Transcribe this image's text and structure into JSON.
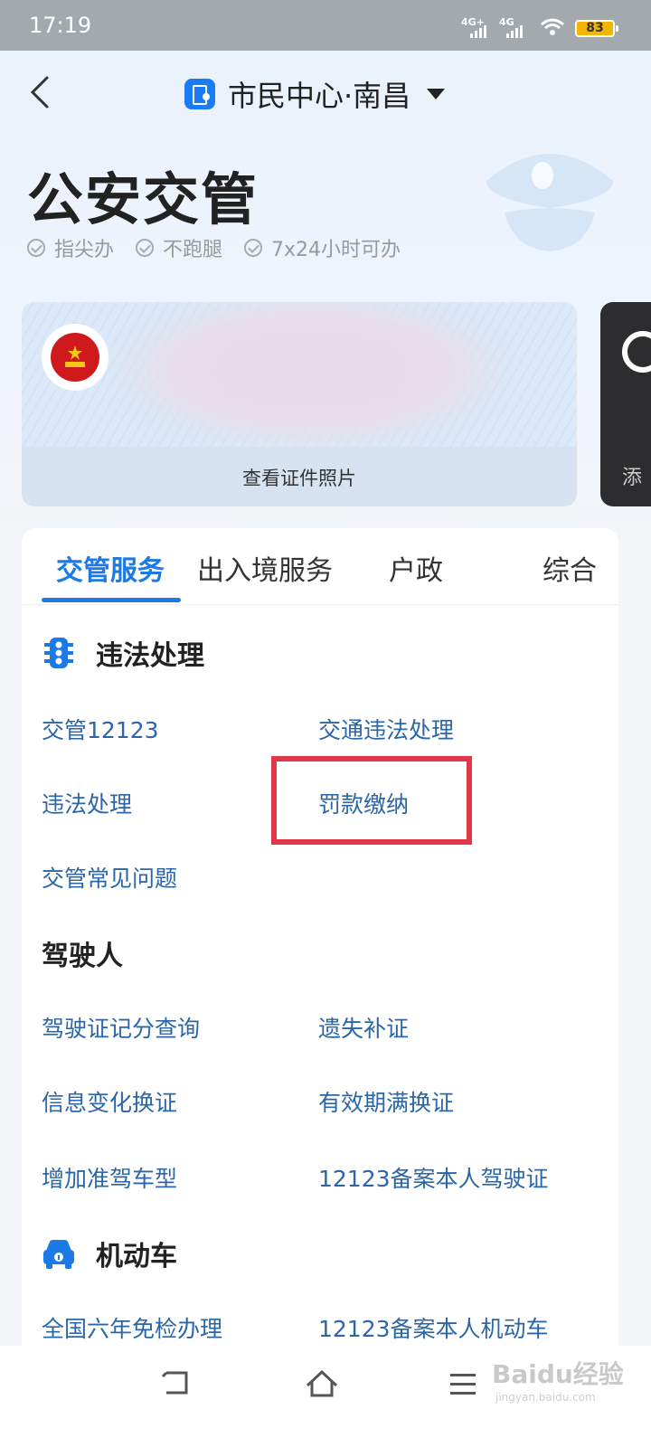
{
  "status_bar": {
    "time": "17:19",
    "network1": "4G+",
    "network2": "4G",
    "battery": "83"
  },
  "nav": {
    "title": "市民中心·南昌"
  },
  "hero": {
    "title": "公安交管",
    "features": [
      "指尖办",
      "不跑腿",
      "7x24小时可办"
    ]
  },
  "card": {
    "view_photo": "查看证件照片",
    "next_card_partial": "添"
  },
  "tabs": [
    "交管服务",
    "出入境服务",
    "户政",
    "综合"
  ],
  "sections": {
    "violation": {
      "title": "违法处理",
      "links": [
        "交管12123",
        "交通违法处理",
        "违法处理",
        "罚款缴纳",
        "交管常见问题"
      ]
    },
    "driver": {
      "title": "驾驶人",
      "links": [
        "驾驶证记分查询",
        "遗失补证",
        "信息变化换证",
        "有效期满换证",
        "增加准驾车型",
        "12123备案本人驾驶证"
      ]
    },
    "vehicle": {
      "title": "机动车",
      "links": [
        "全国六年免检办理",
        "12123备案本人机动车"
      ]
    }
  },
  "watermark": {
    "text": "Baidu经验",
    "sub": "jingyan.baidu.com"
  },
  "colors": {
    "accent": "#1b7ae6",
    "link": "#2b66a8",
    "highlight": "#e0384a"
  }
}
